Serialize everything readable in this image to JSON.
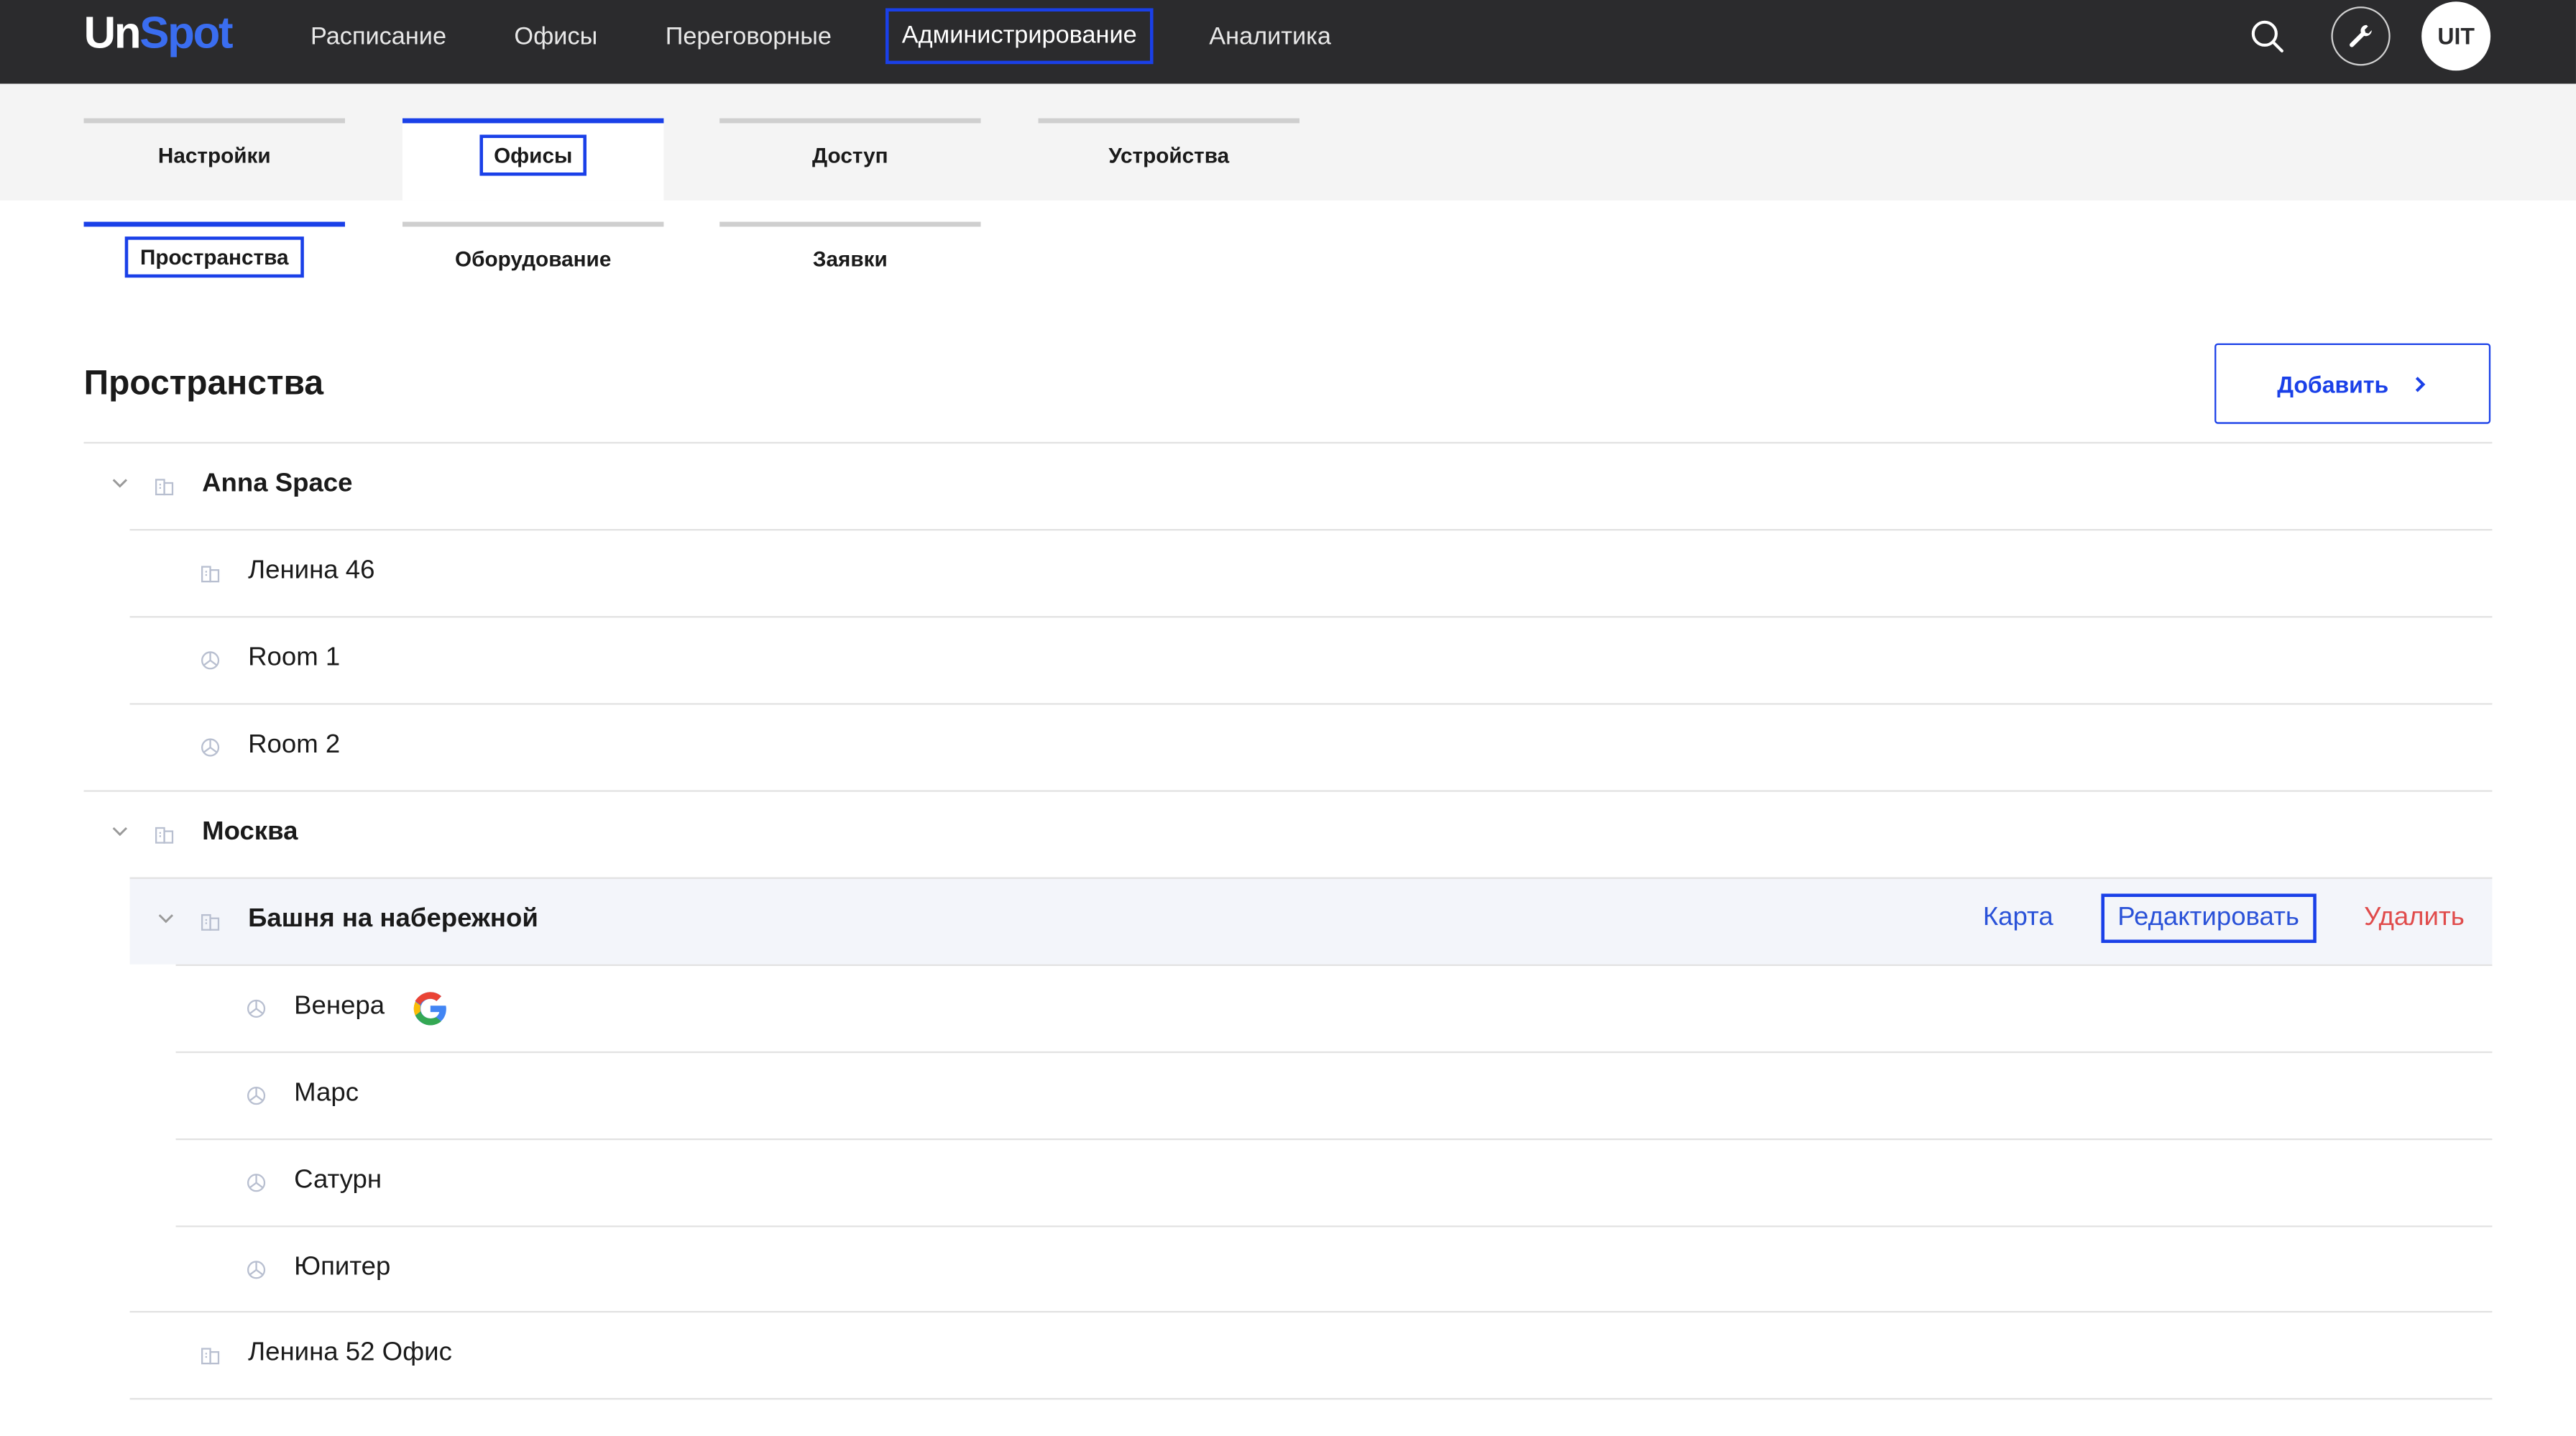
{
  "app": {
    "logo_un": "Un",
    "logo_spot": "Spot"
  },
  "topnav": {
    "items": [
      "Расписание",
      "Офисы",
      "Переговорные",
      "Администрирование",
      "Аналитика"
    ],
    "active": "Администрирование"
  },
  "topbar": {
    "search_icon": "search-icon",
    "settings_icon": "wrench-icon",
    "avatar_text": "UIT"
  },
  "tabs": [
    "Настройки",
    "Офисы",
    "Доступ",
    "Устройства"
  ],
  "active_tab": "Офисы",
  "subtabs": [
    "Пространства",
    "Оборудование",
    "Заявки"
  ],
  "active_subtab": "Пространства",
  "page": {
    "title": "Пространства",
    "add_label": "Добавить"
  },
  "tree": [
    {
      "label": "Anna Space",
      "level": 0,
      "bold": true,
      "expandable": true,
      "icon": "building-icon"
    },
    {
      "label": "Ленина 46",
      "level": 1,
      "bold": false,
      "icon": "building-icon"
    },
    {
      "label": "Room 1",
      "level": 1,
      "bold": false,
      "icon": "room-icon"
    },
    {
      "label": "Room 2",
      "level": 1,
      "bold": false,
      "icon": "room-icon"
    },
    {
      "label": "Москва",
      "level": 0,
      "bold": true,
      "expandable": true,
      "icon": "building-icon"
    },
    {
      "label": "Башня на набережной",
      "level": 1,
      "bold": true,
      "expandable": true,
      "icon": "building-icon",
      "highlighted": true
    },
    {
      "label": "Венера",
      "level": 2,
      "bold": false,
      "icon": "room-icon",
      "badge": "google-icon"
    },
    {
      "label": "Марс",
      "level": 2,
      "bold": false,
      "icon": "room-icon"
    },
    {
      "label": "Сатурн",
      "level": 2,
      "bold": false,
      "icon": "room-icon"
    },
    {
      "label": "Юпитер",
      "level": 2,
      "bold": false,
      "icon": "room-icon"
    },
    {
      "label": "Ленина 52 Офис",
      "level": 1,
      "bold": false,
      "icon": "building-icon"
    }
  ],
  "row_actions": {
    "map": "Карта",
    "edit": "Редактировать",
    "delete": "Удалить"
  },
  "colors": {
    "accent": "#1a40e8",
    "danger": "#e04b4b",
    "topbar": "#2b2b2d",
    "link": "#2a52d8"
  }
}
